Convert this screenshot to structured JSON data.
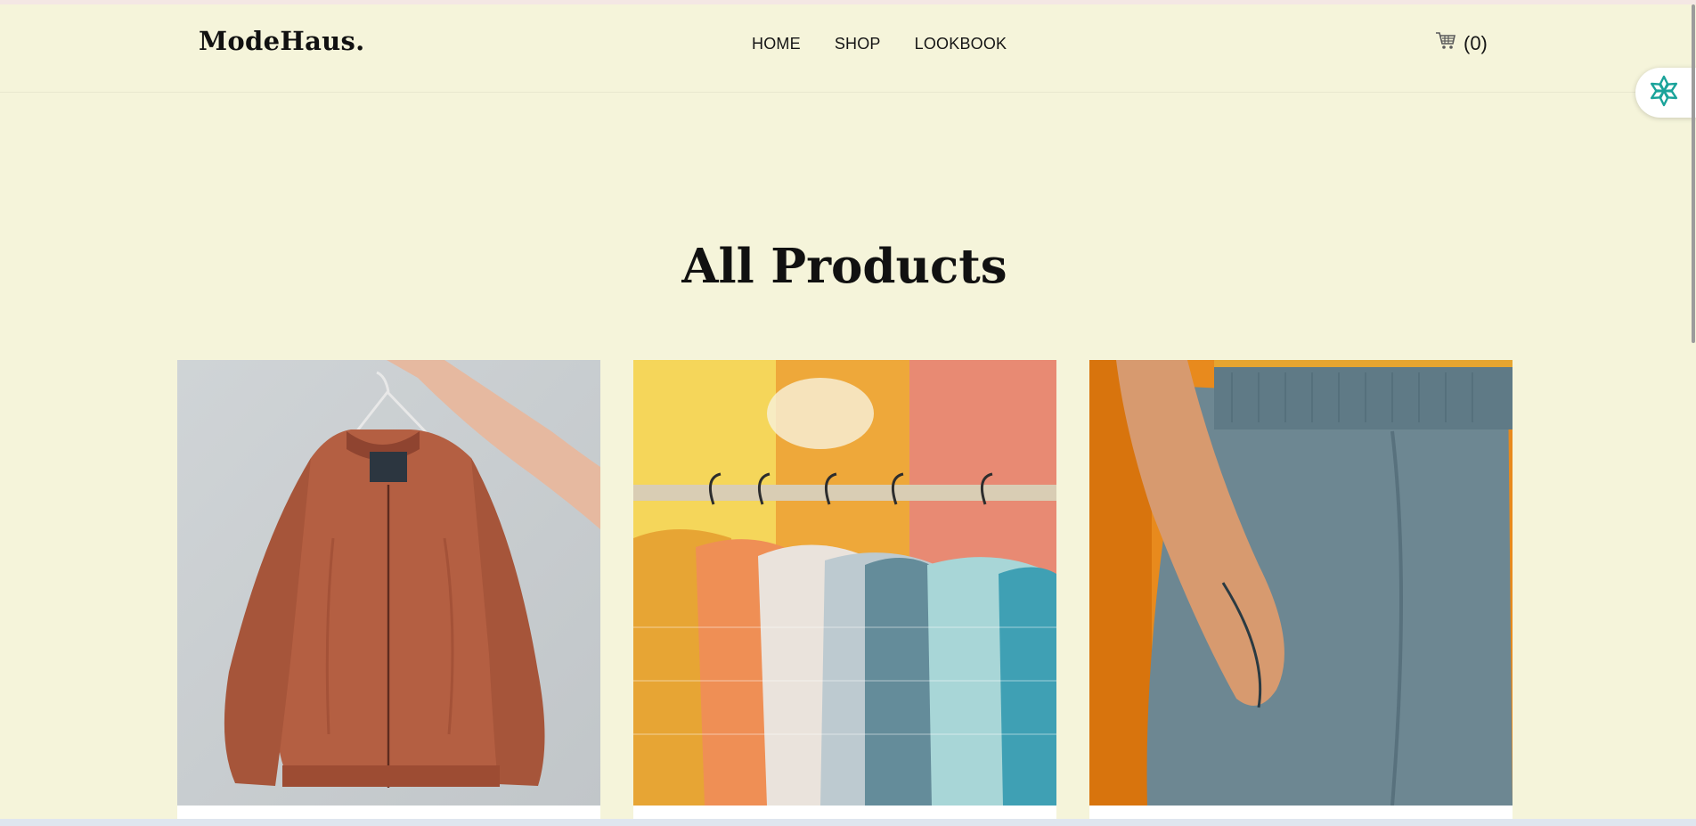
{
  "header": {
    "logo": "ModeHaus.",
    "nav": [
      "HOME",
      "SHOP",
      "LOOKBOOK"
    ],
    "cart_icon": "cart-icon",
    "cart_count": "(0)"
  },
  "main": {
    "title": "All Products",
    "products": [
      {
        "image": "rust-bomber-jacket-on-hanger-photo"
      },
      {
        "image": "colorful-puffer-jackets-on-rack-photo"
      },
      {
        "image": "person-in-gray-sweatpants-photo"
      }
    ]
  },
  "widget": {
    "icon": "assistant-flower-icon"
  },
  "colors": {
    "background": "#f5f4da",
    "text": "#151515",
    "widget_accent": "#1aa39a"
  }
}
